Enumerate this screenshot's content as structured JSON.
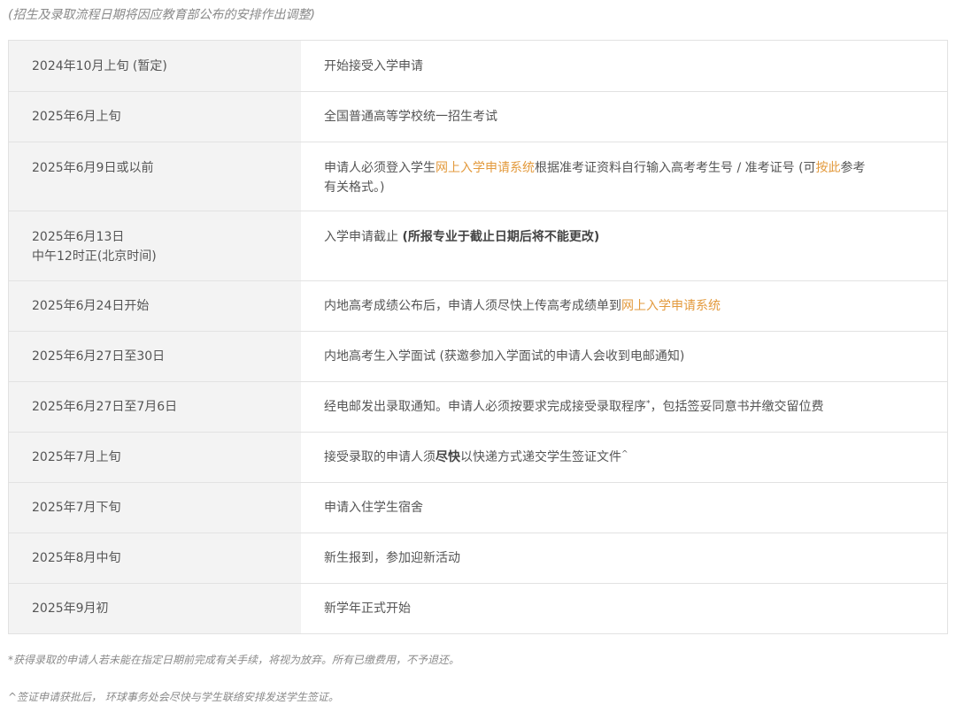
{
  "notice": "(招生及录取流程日期将因应教育部公布的安排作出调整)",
  "rows": [
    {
      "date": "2024年10月上旬 (暂定)",
      "desc": "开始接受入学申请"
    },
    {
      "date": "2025年6月上旬",
      "desc": "全国普通高等学校统一招生考试"
    },
    {
      "date": "2025年6月9日或以前",
      "desc_a": "申请人必须登入学生",
      "desc_link1": "网上入学申请系统",
      "desc_b": "根据准考证资料自行输入高考考生号 / 准考证号 (可",
      "desc_link2": "按此",
      "desc_c": "参考",
      "desc_d": "有关格式。)"
    },
    {
      "date_line1": "2025年6月13日",
      "date_line2": "中午12时正(北京时间)",
      "desc_a": "入学申请截止 ",
      "desc_bold": "(所报专业于截止日期后将不能更改)"
    },
    {
      "date": "2025年6月24日开始",
      "desc_a": "内地高考成绩公布后，申请人须尽快上传高考成绩单到",
      "desc_link": "网上入学申请系统"
    },
    {
      "date": "2025年6月27日至30日",
      "desc": "内地高考生入学面试 (获邀参加入学面试的申请人会收到电邮通知)"
    },
    {
      "date": "2025年6月27日至7月6日",
      "desc_a": "经电邮发出录取通知。申请人必须按要求完成接受录取程序",
      "desc_sup": "*",
      "desc_b": "，包括签妥同意书并缴交留位费"
    },
    {
      "date": "2025年7月上旬",
      "desc_a": "接受录取的申请人须",
      "desc_bold": "尽快",
      "desc_b": "以快递方式递交学生签证文件",
      "desc_sup": "^"
    },
    {
      "date": "2025年7月下旬",
      "desc": "申请入住学生宿舍"
    },
    {
      "date": "2025年8月中旬",
      "desc": "新生报到，参加迎新活动"
    },
    {
      "date": "2025年9月初",
      "desc": "新学年正式开始"
    }
  ],
  "footnotes": {
    "star": "*获得录取的申请人若未能在指定日期前完成有关手续，将视为放弃。所有已缴费用，不予退还。",
    "caret": "^签证申请获批后， 环球事务处会尽快与学生联络安排发送学生签证。"
  }
}
